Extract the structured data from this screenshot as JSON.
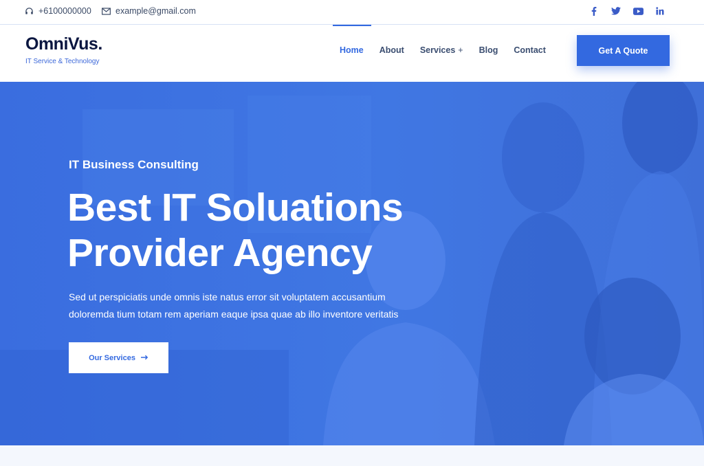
{
  "topbar": {
    "phone": "+6100000000",
    "email": "example@gmail.com",
    "social": [
      "facebook-icon",
      "twitter-icon",
      "youtube-icon",
      "linkedin-icon"
    ]
  },
  "header": {
    "logo_name": "OmniVus.",
    "logo_tagline": "IT Service & Technology",
    "nav": [
      {
        "label": "Home",
        "active": true
      },
      {
        "label": "About"
      },
      {
        "label": "Services"
      },
      {
        "label": "Blog"
      },
      {
        "label": "Contact"
      }
    ],
    "services_plus": "+",
    "quote_button": "Get A Quote"
  },
  "hero": {
    "subtitle": "IT Business Consulting",
    "title_line1": "Best IT Soluations",
    "title_line2": "Provider Agency",
    "desc_line1": "Sed ut perspiciatis unde omnis iste natus error sit voluptatem accusantium",
    "desc_line2": "doloremda tium totam rem aperiam eaque ipsa quae ab illo inventore veritatis",
    "button": "Our Services"
  },
  "colors": {
    "accent": "#3369e0",
    "hero_overlay": "#3d71e0",
    "dark_text": "#0b1640"
  }
}
